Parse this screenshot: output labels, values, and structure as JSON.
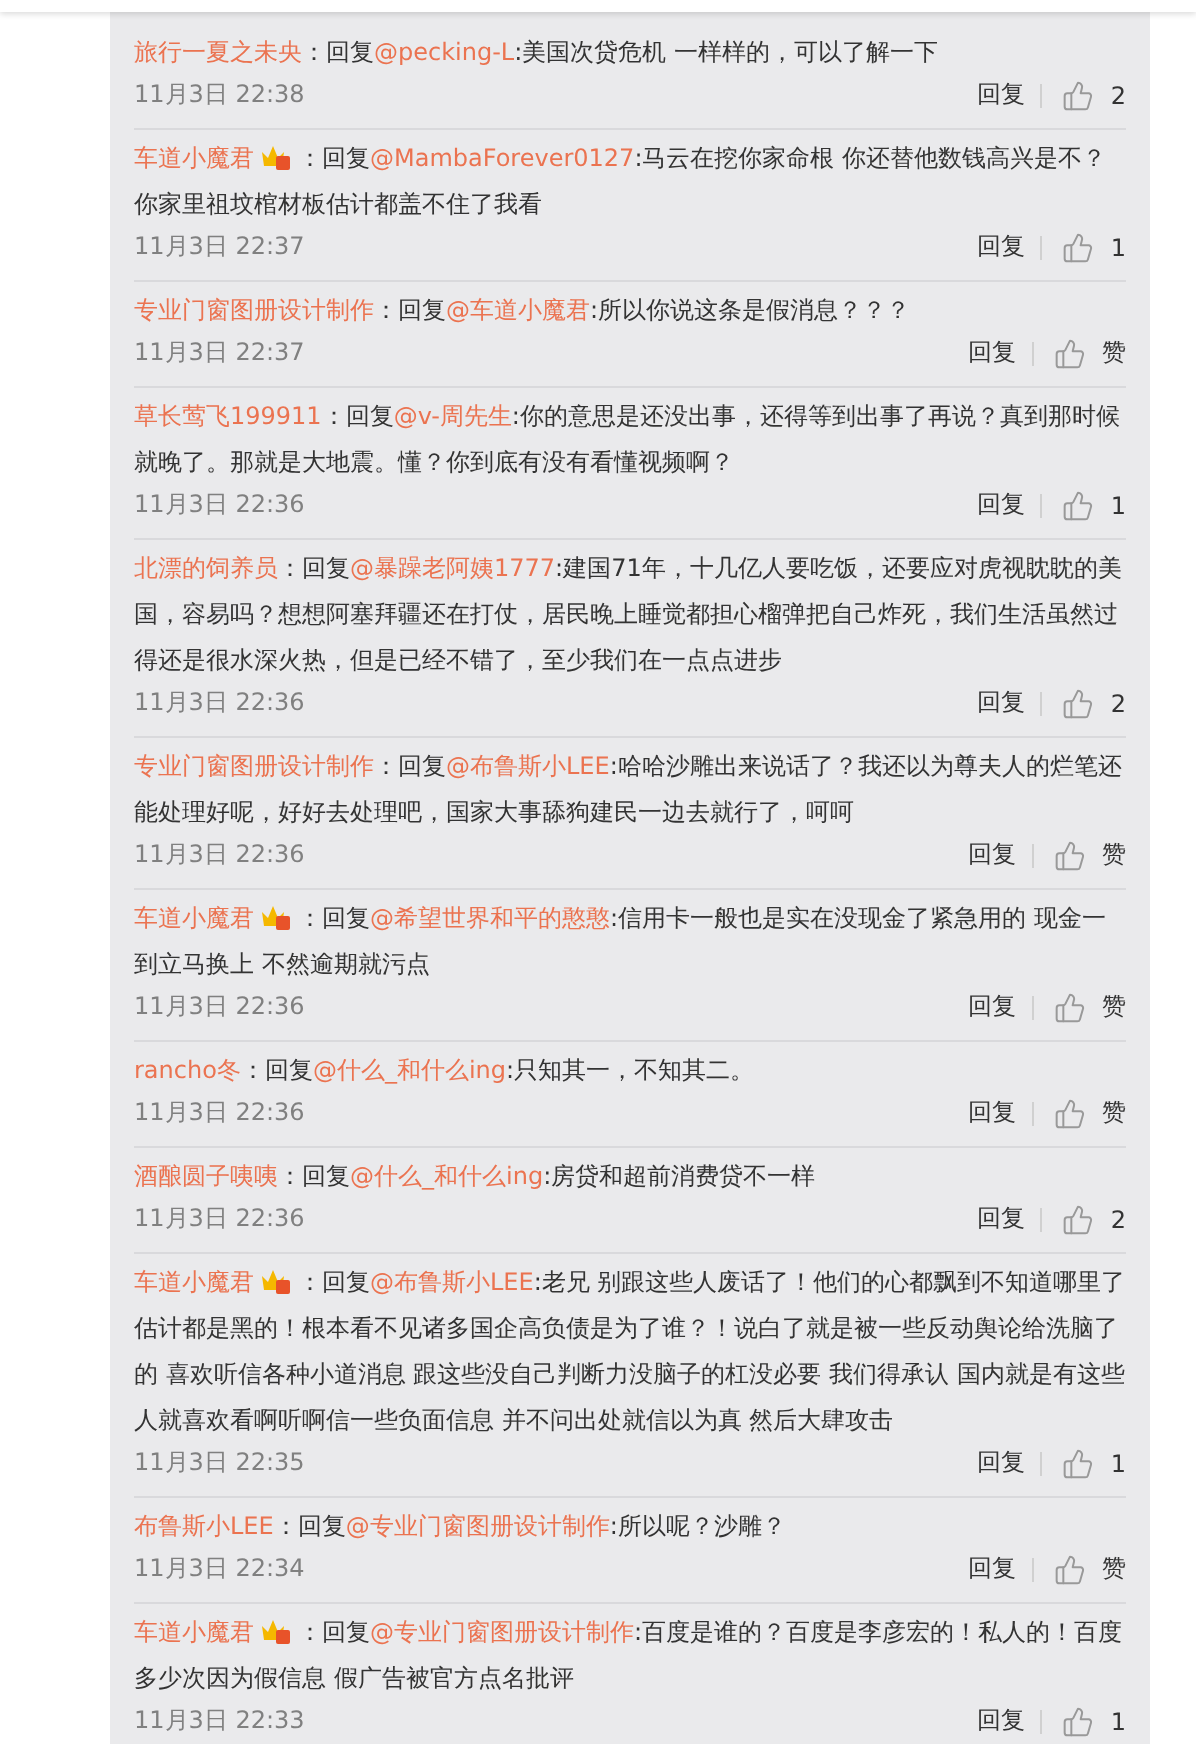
{
  "comments": [
    {
      "user": "旅行一夏之未央",
      "vip": false,
      "prefix": "：回复",
      "mention": "@pecking-L",
      "text": ":美国次贷危机 一样样的，可以了解一下",
      "time": "11月3日 22:38",
      "reply": "回复",
      "likes": "2"
    },
    {
      "user": "车道小魔君",
      "vip": true,
      "prefix": "：回复",
      "mention": "@MambaForever0127",
      "text": ":马云在挖你家命根 你还替他数钱高兴是不？你家里祖坟棺材板估计都盖不住了我看",
      "time": "11月3日 22:37",
      "reply": "回复",
      "likes": "1"
    },
    {
      "user": "专业门窗图册设计制作",
      "vip": false,
      "prefix": "：回复",
      "mention": "@车道小魔君",
      "text": ":所以你说这条是假消息？？？",
      "time": "11月3日 22:37",
      "reply": "回复",
      "likes": "赞"
    },
    {
      "user": "草长莺飞199911",
      "vip": false,
      "prefix": "：回复",
      "mention": "@v-周先生",
      "text": ":你的意思是还没出事，还得等到出事了再说？真到那时候就晚了。那就是大地震。懂？你到底有没有看懂视频啊？",
      "time": "11月3日 22:36",
      "reply": "回复",
      "likes": "1"
    },
    {
      "user": "北漂的饲养员",
      "vip": false,
      "prefix": "：回复",
      "mention": "@暴躁老阿姨1777",
      "text": ":建国71年，十几亿人要吃饭，还要应对虎视眈眈的美国，容易吗？想想阿塞拜疆还在打仗，居民晚上睡觉都担心榴弹把自己炸死，我们生活虽然过得还是很水深火热，但是已经不错了，至少我们在一点点进步",
      "time": "11月3日 22:36",
      "reply": "回复",
      "likes": "2"
    },
    {
      "user": "专业门窗图册设计制作",
      "vip": false,
      "prefix": "：回复",
      "mention": "@布鲁斯小LEE",
      "text": ":哈哈沙雕出来说话了？我还以为尊夫人的烂笔还能处理好呢，好好去处理吧，国家大事舔狗建民一边去就行了，呵呵",
      "time": "11月3日 22:36",
      "reply": "回复",
      "likes": "赞"
    },
    {
      "user": "车道小魔君",
      "vip": true,
      "prefix": "：回复",
      "mention": "@希望世界和平的憨憨",
      "text": ":信用卡一般也是实在没现金了紧急用的 现金一到立马换上 不然逾期就污点",
      "time": "11月3日 22:36",
      "reply": "回复",
      "likes": "赞"
    },
    {
      "user": "rancho冬",
      "vip": false,
      "prefix": "：回复",
      "mention": "@什么_和什么ing",
      "text": ":只知其一，不知其二。",
      "time": "11月3日 22:36",
      "reply": "回复",
      "likes": "赞"
    },
    {
      "user": "酒酿圆子咦咦",
      "vip": false,
      "prefix": "：回复",
      "mention": "@什么_和什么ing",
      "text": ":房贷和超前消费贷不一样",
      "time": "11月3日 22:36",
      "reply": "回复",
      "likes": "2"
    },
    {
      "user": "车道小魔君",
      "vip": true,
      "prefix": "：回复",
      "mention": "@布鲁斯小LEE",
      "text": ":老兄 别跟这些人废话了！他们的心都飘到不知道哪里了估计都是黑的！根本看不见诸多国企高负债是为了谁？！说白了就是被一些反动舆论给洗脑了的 喜欢听信各种小道消息 跟这些没自己判断力没脑子的杠没必要 我们得承认 国内就是有这些人就喜欢看啊听啊信一些负面信息 并不问出处就信以为真 然后大肆攻击",
      "time": "11月3日 22:35",
      "reply": "回复",
      "likes": "1"
    },
    {
      "user": "布鲁斯小LEE",
      "vip": false,
      "prefix": "：回复",
      "mention": "@专业门窗图册设计制作",
      "text": ":所以呢？沙雕？",
      "time": "11月3日 22:34",
      "reply": "回复",
      "likes": "赞"
    },
    {
      "user": "车道小魔君",
      "vip": true,
      "prefix": "：回复",
      "mention": "@专业门窗图册设计制作",
      "text": ":百度是谁的？百度是李彦宏的！私人的！百度多少次因为假信息 假广告被官方点名批评",
      "time": "11月3日 22:33",
      "reply": "回复",
      "likes": "1"
    }
  ]
}
